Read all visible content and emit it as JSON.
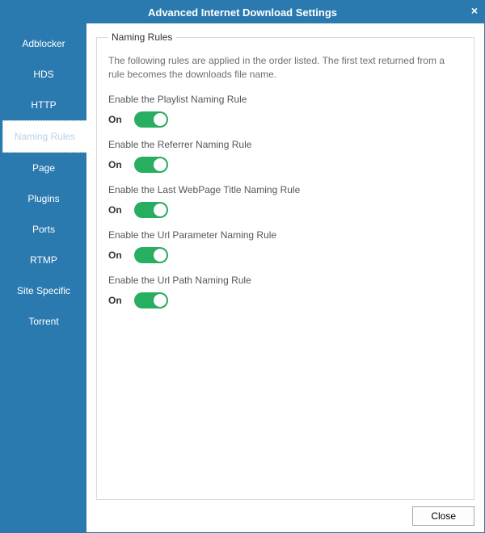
{
  "title": "Advanced Internet Download Settings",
  "sidebar": {
    "items": [
      {
        "label": "Adblocker"
      },
      {
        "label": "HDS"
      },
      {
        "label": "HTTP"
      },
      {
        "label": "Naming Rules"
      },
      {
        "label": "Page"
      },
      {
        "label": "Plugins"
      },
      {
        "label": "Ports"
      },
      {
        "label": "RTMP"
      },
      {
        "label": "Site Specific"
      },
      {
        "label": "Torrent"
      }
    ],
    "active_index": 3
  },
  "panel": {
    "legend": "Naming Rules",
    "description": "The following rules are applied in the order listed. The first text returned from a rule becomes the downloads file name.",
    "rules": [
      {
        "label": "Enable the Playlist Naming Rule",
        "state_label": "On",
        "on": true
      },
      {
        "label": "Enable the Referrer Naming Rule",
        "state_label": "On",
        "on": true
      },
      {
        "label": "Enable the Last WebPage Title Naming Rule",
        "state_label": "On",
        "on": true
      },
      {
        "label": "Enable the Url Parameter Naming Rule",
        "state_label": "On",
        "on": true
      },
      {
        "label": "Enable the Url Path Naming Rule",
        "state_label": "On",
        "on": true
      }
    ]
  },
  "footer": {
    "close_label": "Close"
  },
  "colors": {
    "brand": "#2a7ab0",
    "toggle_on": "#27ae60"
  }
}
